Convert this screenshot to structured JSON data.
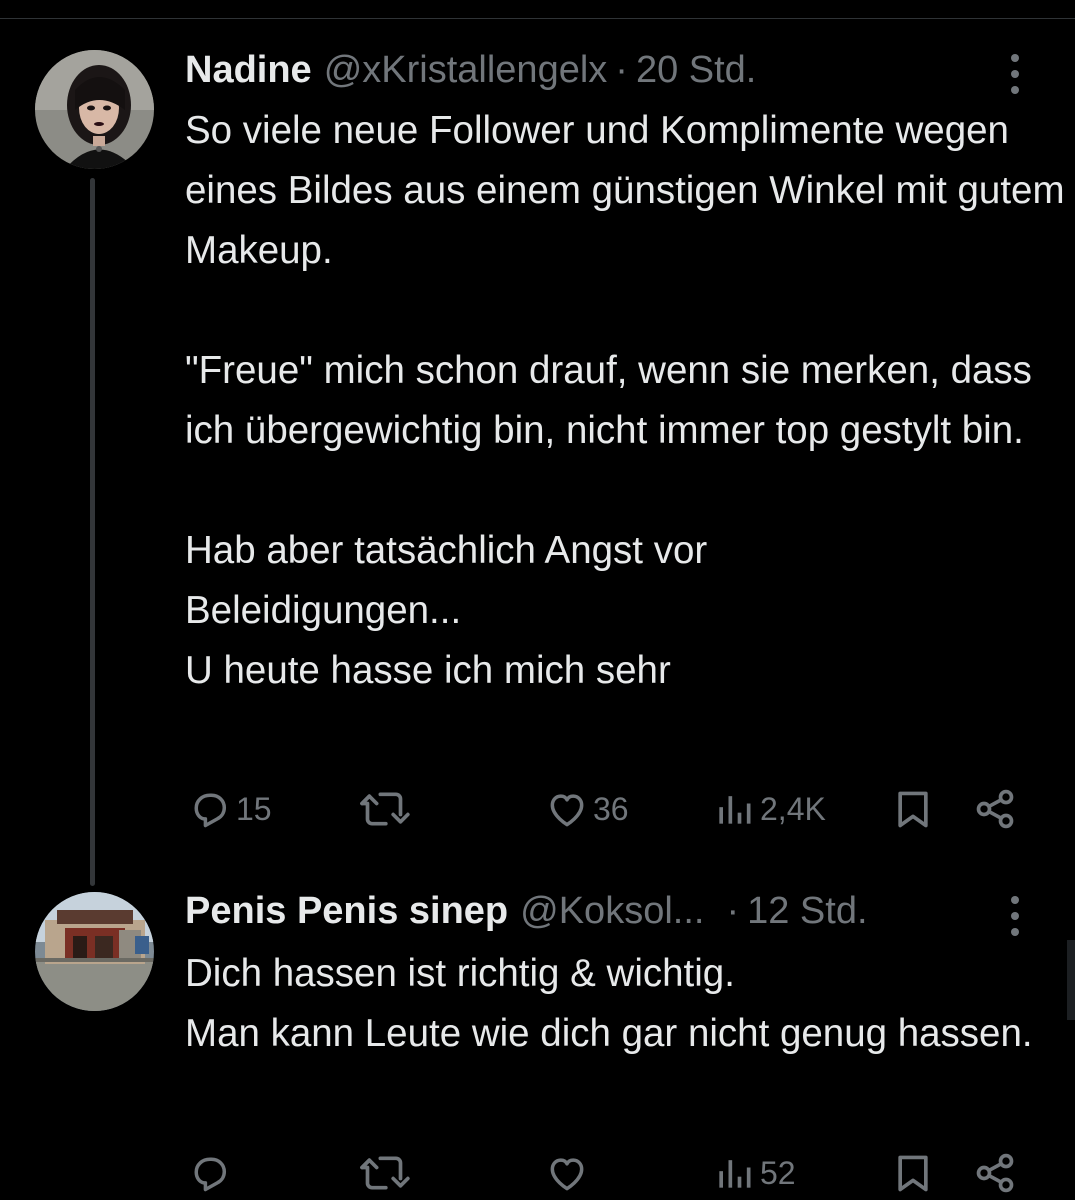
{
  "tweets": [
    {
      "name": "Nadine",
      "handle": "@xKristallengelx",
      "separator": "·",
      "time": "20 Std.",
      "avatar_icon": "profile-photo",
      "paragraphs": [
        "So viele neue Follower und Komplimente wegen eines Bildes aus einem günstigen Winkel mit gutem Makeup.",
        "\"Freue\" mich schon drauf, wenn sie merken, dass ich übergewichtig bin, nicht immer top gestylt bin.",
        "Hab aber tatsächlich Angst vor Beleidigungen...",
        "U heute hasse ich mich sehr"
      ],
      "replies": "15",
      "retweets": "",
      "likes": "36",
      "views": "2,4K"
    },
    {
      "name": "Penis Penis sinep",
      "handle": "@Koksol...",
      "separator": "·",
      "time": "12 Std.",
      "avatar_icon": "building-photo",
      "paragraphs": [
        "Dich hassen ist richtig & wichtig.",
        "Man kann Leute wie dich gar nicht genug hassen."
      ],
      "replies": "",
      "retweets": "",
      "likes": "",
      "views": "52"
    }
  ],
  "colors": {
    "background": "#000000",
    "text": "#e7e9ea",
    "secondary": "#71767b",
    "thread_line": "#333639",
    "divider": "#2f3336"
  },
  "icons": [
    "reply-icon",
    "retweet-icon",
    "like-icon",
    "views-icon",
    "bookmark-icon",
    "share-icon",
    "more-icon"
  ]
}
